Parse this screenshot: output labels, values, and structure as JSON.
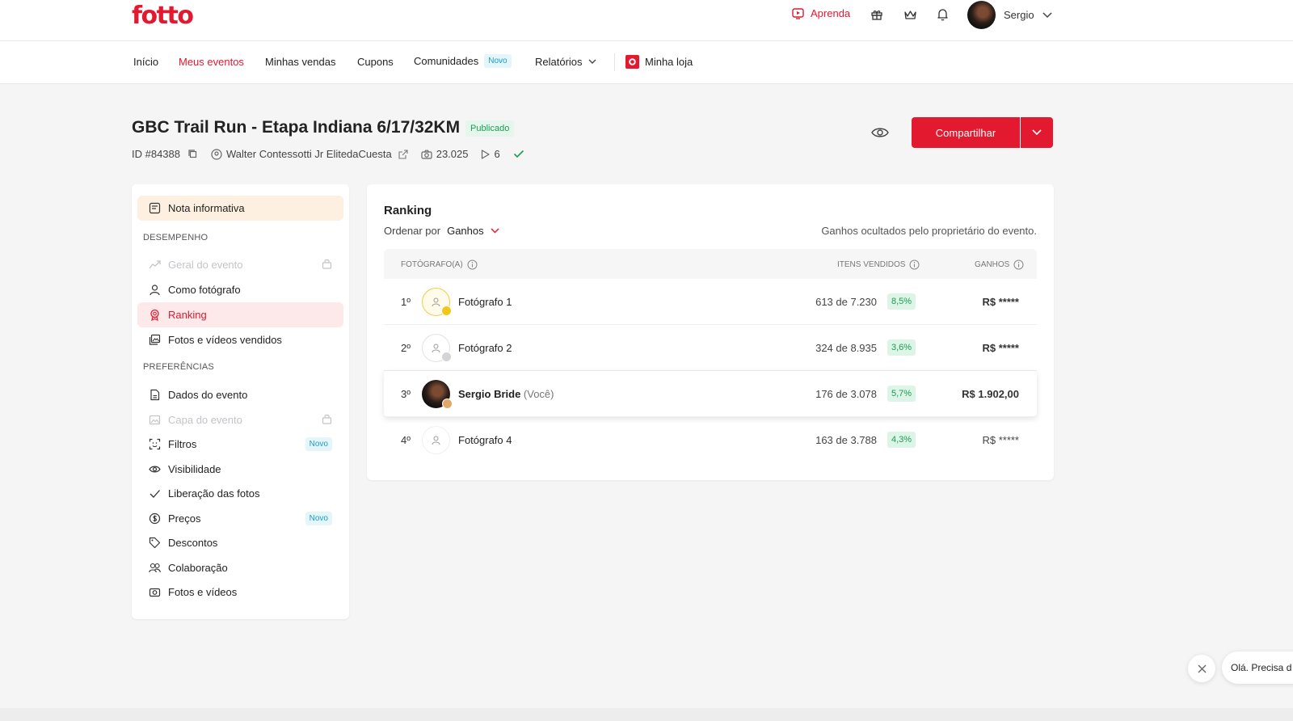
{
  "brand": {
    "logo": "fotto",
    "accent": "#e2192f"
  },
  "topbar": {
    "aprenda": "Aprenda",
    "user_name": "Sergio",
    "icons": [
      "gift-icon",
      "crown-icon",
      "bell-icon"
    ]
  },
  "nav": {
    "items": [
      "Início",
      "Meus eventos",
      "Minhas vendas",
      "Cupons",
      "Comunidades",
      "Relatórios",
      "Minha loja"
    ],
    "new_badge": "Novo"
  },
  "event": {
    "title": "GBC Trail Run - Etapa Indiana 6/17/32KM",
    "status": "Publicado",
    "id": "ID #84388",
    "organizer": "Walter Contessotti Jr ElitedaCuesta",
    "photos": "23.025",
    "videos": "6"
  },
  "actions": {
    "share": "Compartilhar"
  },
  "sidebar": {
    "note": "Nota informativa",
    "section_performance": "DESEMPENHO",
    "performance_items": [
      "Geral do evento",
      "Como fotógrafo",
      "Ranking",
      "Fotos e vídeos vendidos"
    ],
    "section_preferences": "PREFERÊNCIAS",
    "preference_items": [
      "Dados do evento",
      "Capa do evento",
      "Filtros",
      "Visibilidade",
      "Liberação das fotos",
      "Preços",
      "Descontos",
      "Colaboração",
      "Fotos e vídeos"
    ],
    "new_badge": "Novo"
  },
  "ranking": {
    "title": "Ranking",
    "order_label": "Ordenar por",
    "order_value": "Ganhos",
    "hidden_note": "Ganhos ocultados pelo proprietário do evento.",
    "columns": {
      "photographer": "FOTÓGRAFO(A)",
      "items_sold": "ITENS VENDIDOS",
      "earnings": "GANHOS"
    },
    "rows": [
      {
        "rank": "1º",
        "name": "Fotógrafo 1",
        "you": "",
        "sold": "613 de 7.230",
        "pct": "8,5%",
        "earnings": "R$ *****"
      },
      {
        "rank": "2º",
        "name": "Fotógrafo 2",
        "you": "",
        "sold": "324 de 8.935",
        "pct": "3,6%",
        "earnings": "R$ *****"
      },
      {
        "rank": "3º",
        "name": "Sergio Bride",
        "you": "(Você)",
        "sold": "176 de 3.078",
        "pct": "5,7%",
        "earnings": "R$ 1.902,00"
      },
      {
        "rank": "4º",
        "name": "Fotógrafo 4",
        "you": "",
        "sold": "163 de 3.788",
        "pct": "4,3%",
        "earnings": "R$ *****"
      }
    ]
  },
  "chat": {
    "text": "Olá. Precisa d"
  }
}
